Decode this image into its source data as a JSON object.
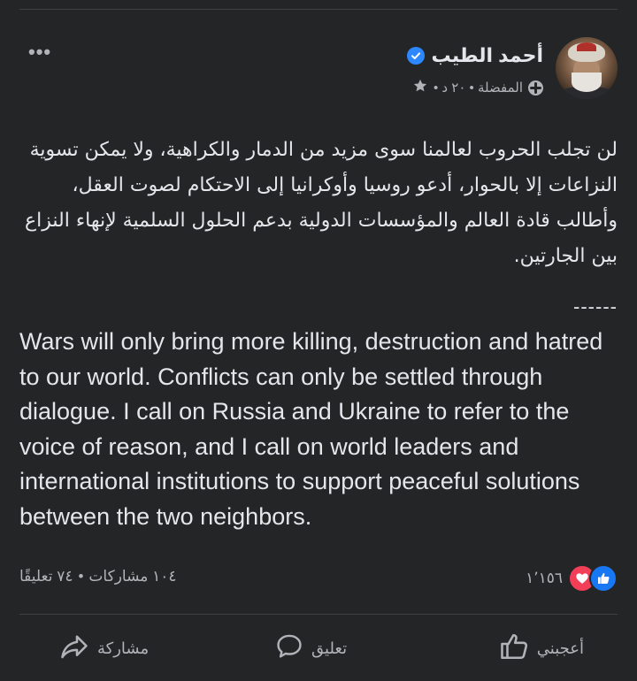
{
  "post": {
    "author_name": "أحمد الطيب",
    "meta_text": "المفضلة • ٢٠ د •",
    "more_label": "•••",
    "arabic_text": "لن تجلب الحروب لعالمنا سوى مزيد من الدمار والكراهية، ولا يمكن تسوية النزاعات إلا بالحوار، أدعو روسيا وأوكرانيا إلى الاحتكام لصوت العقل، وأطالب قادة العالم والمؤسسات الدولية بدعم الحلول السلمية لإنهاء النزاع بين الجارتين.",
    "separator": "------",
    "english_text": "Wars will only bring more killing, destruction and hatred to our world. Conflicts can only be settled through dialogue. I call on Russia and Ukraine  to refer to the voice of reason, and I call on world leaders and international institutions to support peaceful solutions between the two neighbors."
  },
  "stats": {
    "reactions_count": "١٬١٥٦",
    "comments": "٧٤ تعليقًا",
    "dot": "•",
    "shares": "١٠٤ مشاركات"
  },
  "actions": {
    "like_label": "أعجبني",
    "comment_label": "تعليق",
    "share_label": "مشاركة"
  },
  "colors": {
    "background": "#242526",
    "text": "#e4e6eb",
    "secondary": "#b0b3b8",
    "like_blue": "#1877f2",
    "love_red": "#f33e58",
    "verified_blue": "#2d88ff"
  },
  "icons": [
    "more-icon",
    "verified-icon",
    "star-icon",
    "globe-icon",
    "like-reaction-icon",
    "love-reaction-icon",
    "like-icon",
    "comment-icon",
    "share-icon"
  ]
}
